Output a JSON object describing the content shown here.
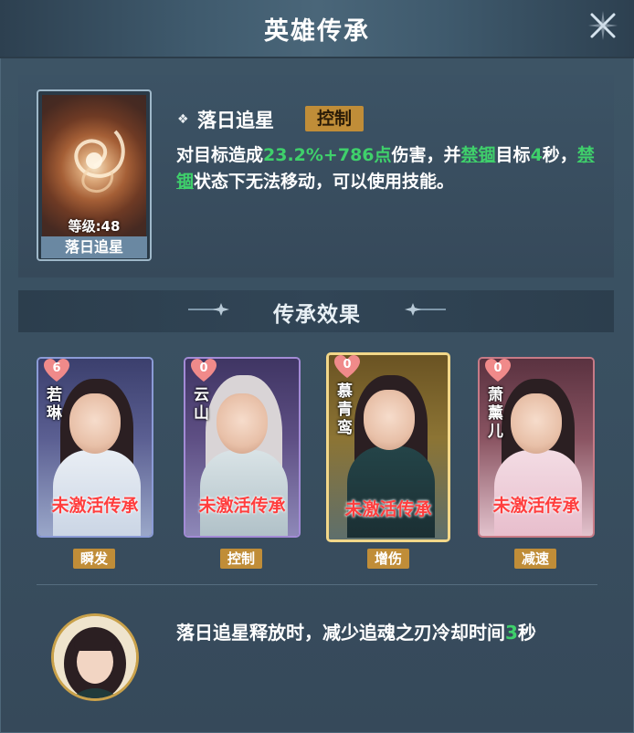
{
  "window": {
    "title": "英雄传承",
    "close_icon": "close-x-icon"
  },
  "skill": {
    "name": "落日追星",
    "tag": "控制",
    "card_level": "等级:48",
    "card_name": "落日追星",
    "desc": {
      "p1": "对目标造成",
      "v1": "23.2%+786点",
      "p2": "伤害，并",
      "k1": "禁锢",
      "p3": "目标",
      "v2": "4",
      "p4": "秒，",
      "k2": "禁锢",
      "p5": "状态下无法移动，可以使用技能。"
    }
  },
  "inherit": {
    "title": "传承效果",
    "heroes": [
      {
        "name": "若琳",
        "count": "6",
        "status": "未激活传承",
        "tag": "瞬发"
      },
      {
        "name": "云山",
        "count": "0",
        "status": "未激活传承",
        "tag": "控制"
      },
      {
        "name": "慕青鸾",
        "count": "0",
        "status": "未激活传承",
        "tag": "增伤"
      },
      {
        "name": "萧薰儿",
        "count": "0",
        "status": "未激活传承",
        "tag": "减速"
      }
    ],
    "effect": {
      "prefix": "落日追星释放时，减少追魂之刃冷却时间",
      "value": "3",
      "suffix": "秒"
    }
  },
  "colors": {
    "accent_gold": "#c08d38",
    "highlight_green": "#3fd06b",
    "inactive_red": "#ff3e3e"
  }
}
